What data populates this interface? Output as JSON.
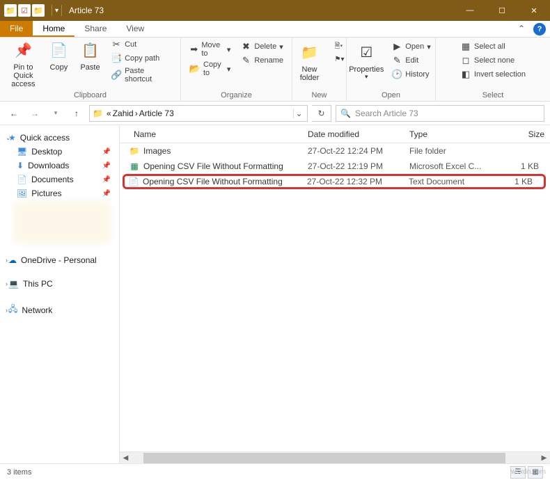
{
  "window": {
    "title": "Article 73"
  },
  "qat": [
    "folder-icon",
    "props-icon",
    "folder-icon"
  ],
  "win_controls": {
    "min": "—",
    "max": "☐",
    "close": "✕"
  },
  "tabs": {
    "file": "File",
    "items": [
      "Home",
      "Share",
      "View"
    ],
    "activeIndex": 0
  },
  "ribbon": {
    "clipboard": {
      "label": "Clipboard",
      "pin": "Pin to Quick access",
      "copy": "Copy",
      "paste": "Paste",
      "cut": "Cut",
      "copy_path": "Copy path",
      "paste_shortcut": "Paste shortcut"
    },
    "organize": {
      "label": "Organize",
      "move_to": "Move to",
      "copy_to": "Copy to",
      "delete": "Delete",
      "rename": "Rename"
    },
    "new": {
      "label": "New",
      "new_folder": "New folder",
      "new_item": "New item",
      "easy_access": "Easy access"
    },
    "open": {
      "label": "Open",
      "properties": "Properties",
      "open": "Open",
      "edit": "Edit",
      "history": "History"
    },
    "select": {
      "label": "Select",
      "all": "Select all",
      "none": "Select none",
      "invert": "Invert selection"
    }
  },
  "address": {
    "crumbs": [
      "«",
      "Zahid",
      "Article 73"
    ],
    "search_placeholder": "Search Article 73"
  },
  "nav": {
    "quick": {
      "label": "Quick access",
      "items": [
        "Desktop",
        "Downloads",
        "Documents",
        "Pictures"
      ]
    },
    "onedrive": "OneDrive - Personal",
    "thispc": "This PC",
    "network": "Network"
  },
  "columns": {
    "name": "Name",
    "date": "Date modified",
    "type": "Type",
    "size": "Size"
  },
  "files": [
    {
      "icon": "folder",
      "name": "Images",
      "date": "27-Oct-22 12:24 PM",
      "type": "File folder",
      "size": ""
    },
    {
      "icon": "xlsx",
      "name": "Opening CSV File Without Formatting",
      "date": "27-Oct-22 12:19 PM",
      "type": "Microsoft Excel C...",
      "size": "1 KB"
    },
    {
      "icon": "txt",
      "name": "Opening CSV File Without Formatting",
      "date": "27-Oct-22 12:32 PM",
      "type": "Text Document",
      "size": "1 KB",
      "highlighted": true
    }
  ],
  "status": {
    "count": "3 items"
  },
  "watermark": "wsxdn.com"
}
